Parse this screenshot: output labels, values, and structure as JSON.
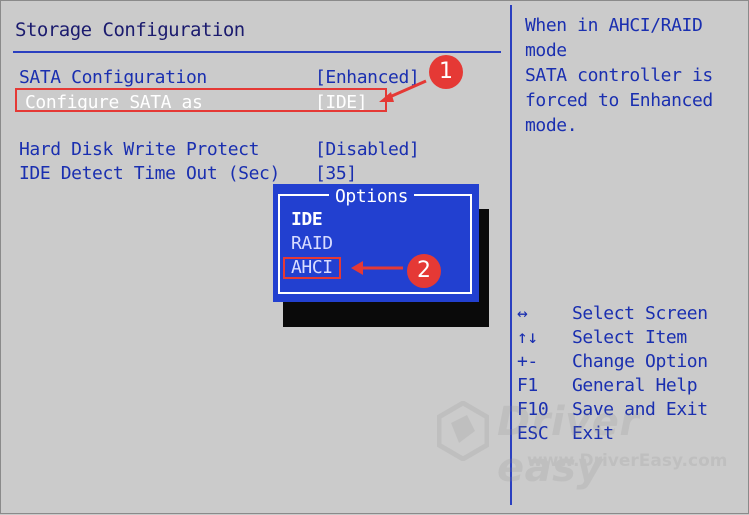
{
  "main": {
    "title": "Storage Configuration",
    "rows": [
      {
        "label": "SATA Configuration",
        "value": "[Enhanced]"
      },
      {
        "label": "Configure SATA as",
        "value": "[IDE]"
      },
      {
        "label": "Hard Disk Write Protect",
        "value": "[Disabled]"
      },
      {
        "label": "IDE Detect Time Out (Sec)",
        "value": "[35]"
      }
    ]
  },
  "help": {
    "lines": [
      "When in AHCI/RAID mode",
      "SATA controller is",
      "forced to Enhanced",
      "mode."
    ]
  },
  "keys": [
    {
      "key": "↔",
      "desc": "Select Screen"
    },
    {
      "key": "↑↓",
      "desc": "Select Item"
    },
    {
      "key": "+-",
      "desc": "Change Option"
    },
    {
      "key": "F1",
      "desc": "General Help"
    },
    {
      "key": "F10",
      "desc": "Save and Exit"
    },
    {
      "key": "ESC",
      "desc": "Exit"
    }
  ],
  "popup": {
    "title": "Options",
    "options": [
      "IDE",
      "RAID",
      "AHCI"
    ]
  },
  "annotations": {
    "step1": "1",
    "step2": "2",
    "color": "#e53935"
  },
  "watermark": {
    "brand": "Driver easy",
    "url": "www.DriverEasy.com"
  },
  "colors": {
    "background": "#cbcbcb",
    "bios_text": "#1a2fb0",
    "popup_bg": "#2240d0",
    "highlight": "#e53935"
  }
}
